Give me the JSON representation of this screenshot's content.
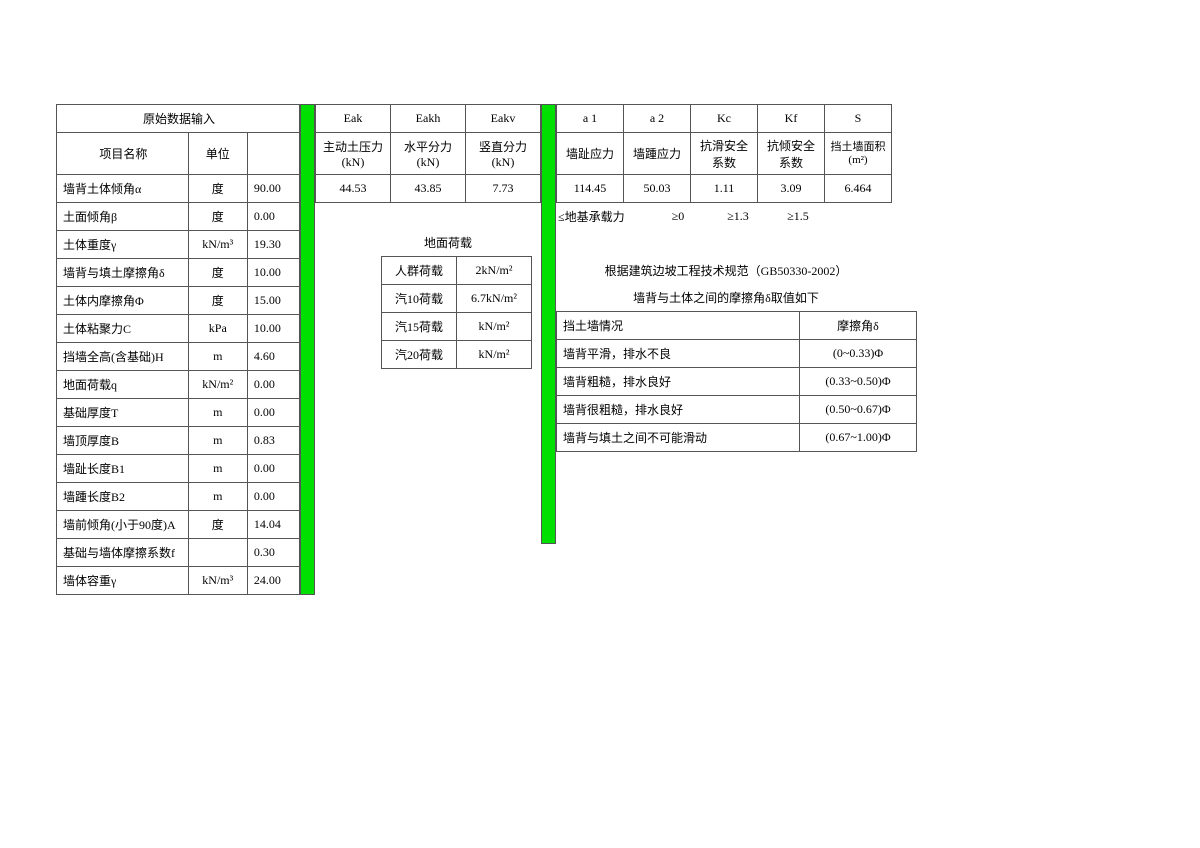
{
  "left": {
    "header": "原始数据输入",
    "col_name": "项目名称",
    "col_unit": "单位",
    "rows": [
      {
        "name": "墙背土体倾角α",
        "unit": "度",
        "val": "90.00"
      },
      {
        "name": "土面倾角β",
        "unit": "度",
        "val": "0.00"
      },
      {
        "name": "土体重度γ",
        "unit": "kN/m³",
        "val": "19.30"
      },
      {
        "name": "墙背与填土摩擦角δ",
        "unit": "度",
        "val": "10.00"
      },
      {
        "name": "土体内摩擦角Φ",
        "unit": "度",
        "val": "15.00"
      },
      {
        "name": "土体粘聚力C",
        "unit": "kPa",
        "val": "10.00"
      },
      {
        "name": "挡墙全高(含基础)H",
        "unit": "m",
        "val": "4.60"
      },
      {
        "name": "地面荷载q",
        "unit": "kN/m²",
        "val": "0.00"
      },
      {
        "name": "基础厚度T",
        "unit": "m",
        "val": "0.00"
      },
      {
        "name": "墙顶厚度B",
        "unit": "m",
        "val": "0.83"
      },
      {
        "name": "墙趾长度B1",
        "unit": "m",
        "val": "0.00"
      },
      {
        "name": "墙踵长度B2",
        "unit": "m",
        "val": "0.00"
      },
      {
        "name": "墙前倾角(小于90度)A",
        "unit": "度",
        "val": "14.04"
      },
      {
        "name": "基础与墙体摩擦系数f",
        "unit": "",
        "val": "0.30"
      },
      {
        "name": "墙体容重γ",
        "unit": "kN/m³",
        "val": "24.00"
      }
    ]
  },
  "mid": {
    "h1": [
      "Eak",
      "Eakh",
      "Eakv"
    ],
    "h2": [
      "主动土压力(kN)",
      "水平分力(kN)",
      "竖直分力(kN)"
    ],
    "vals": [
      "44.53",
      "43.85",
      "7.73"
    ]
  },
  "right_top": {
    "h1": [
      "а 1",
      "а 2",
      "Kc",
      "Kf",
      "S"
    ],
    "h2": [
      "墙趾应力",
      "墙踵应力",
      "抗滑安全系数",
      "抗倾安全系数",
      "挡土墙面积(m²)"
    ],
    "vals": [
      "114.45",
      "50.03",
      "1.11",
      "3.09",
      "6.464"
    ],
    "note": [
      "≤地基承载力",
      "≥0",
      "≥1.3",
      "≥1.5"
    ]
  },
  "ground_load": {
    "title": "地面荷载",
    "rows": [
      {
        "a": "人群荷载",
        "b": "2kN/m²"
      },
      {
        "a": "汽10荷载",
        "b": "6.7kN/m²"
      },
      {
        "a": "汽15荷载",
        "b": "kN/m²"
      },
      {
        "a": "汽20荷载",
        "b": "kN/m²"
      }
    ]
  },
  "delta": {
    "line1": "根据建筑边坡工程技术规范（GB50330-2002）",
    "line2": "墙背与土体之间的摩擦角δ取值如下",
    "hdr": [
      "挡土墙情况",
      "摩擦角δ"
    ],
    "rows": [
      {
        "a": "墙背平滑，排水不良",
        "b": "(0~0.33)Φ"
      },
      {
        "a": "墙背粗糙，排水良好",
        "b": "(0.33~0.50)Φ"
      },
      {
        "a": "墙背很粗糙，排水良好",
        "b": "(0.50~0.67)Φ"
      },
      {
        "a": "墙背与填土之间不可能滑动",
        "b": "(0.67~1.00)Φ"
      }
    ]
  }
}
